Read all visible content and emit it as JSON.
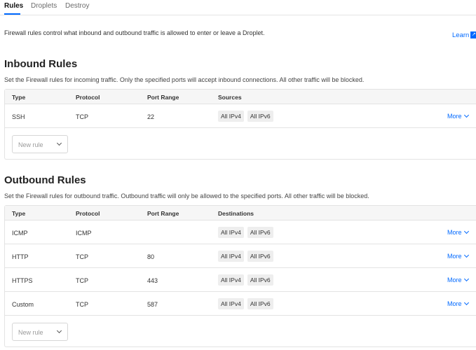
{
  "tabs": [
    {
      "label": "Rules",
      "active": true
    },
    {
      "label": "Droplets",
      "active": false
    },
    {
      "label": "Destroy",
      "active": false
    }
  ],
  "intro": "Firewall rules control what inbound and outbound traffic is allowed to enter or leave a Droplet.",
  "learn_label": "Learn",
  "inbound": {
    "title": "Inbound Rules",
    "description": "Set the Firewall rules for incoming traffic. Only the specified ports will accept inbound connections. All other traffic will be blocked.",
    "headers": {
      "type": "Type",
      "protocol": "Protocol",
      "port_range": "Port Range",
      "targets": "Sources"
    },
    "rows": [
      {
        "type": "SSH",
        "protocol": "TCP",
        "port_range": "22",
        "targets": [
          "All IPv4",
          "All IPv6"
        ],
        "more": "More"
      }
    ],
    "new_rule_placeholder": "New rule"
  },
  "outbound": {
    "title": "Outbound Rules",
    "description": "Set the Firewall rules for outbound traffic. Outbound traffic will only be allowed to the specified ports. All other traffic will be blocked.",
    "headers": {
      "type": "Type",
      "protocol": "Protocol",
      "port_range": "Port Range",
      "targets": "Destinations"
    },
    "rows": [
      {
        "type": "ICMP",
        "protocol": "ICMP",
        "port_range": "",
        "targets": [
          "All IPv4",
          "All IPv6"
        ],
        "more": "More"
      },
      {
        "type": "HTTP",
        "protocol": "TCP",
        "port_range": "80",
        "targets": [
          "All IPv4",
          "All IPv6"
        ],
        "more": "More"
      },
      {
        "type": "HTTPS",
        "protocol": "TCP",
        "port_range": "443",
        "targets": [
          "All IPv4",
          "All IPv6"
        ],
        "more": "More"
      },
      {
        "type": "Custom",
        "protocol": "TCP",
        "port_range": "587",
        "targets": [
          "All IPv4",
          "All IPv6"
        ],
        "more": "More"
      }
    ],
    "new_rule_placeholder": "New rule"
  },
  "colors": {
    "accent": "#0069ff",
    "pill_bg": "#eeeeee",
    "header_bg": "#f6f6f6"
  }
}
